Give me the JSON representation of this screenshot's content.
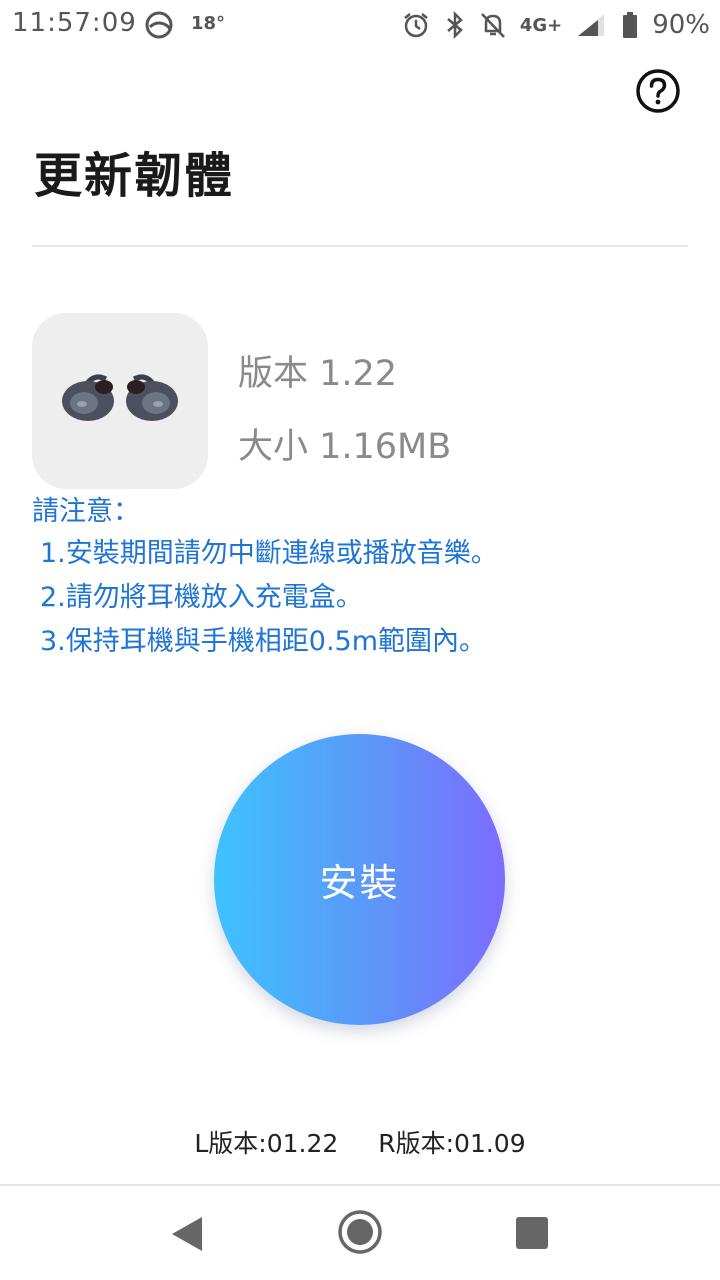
{
  "status_bar": {
    "time": "11:57:09",
    "temperature": "18°",
    "network": "4G+",
    "battery": "90%",
    "icons": [
      "weather-icon",
      "alarm-icon",
      "bluetooth-icon",
      "notifications-off-icon",
      "signal-icon",
      "battery-icon"
    ]
  },
  "header": {
    "title": "更新韌體",
    "help_icon": "help-icon"
  },
  "product": {
    "version": "版本 1.22",
    "size": "大小 1.16MB"
  },
  "notes": {
    "title": "請注意：",
    "items": [
      "1.安裝期間請勿中斷連線或播放音樂。",
      "2.請勿將耳機放入充電盒。",
      "3.保持耳機與手機相距0.5m範圍內。"
    ]
  },
  "install": {
    "label": "安裝"
  },
  "firmware": {
    "left": "L版本:01.22",
    "right": "R版本:01.09"
  },
  "colors": {
    "accent_text": "#1f75d6",
    "button_gradient_start": "#3ec2ff",
    "button_gradient_end": "#7d6cff"
  }
}
